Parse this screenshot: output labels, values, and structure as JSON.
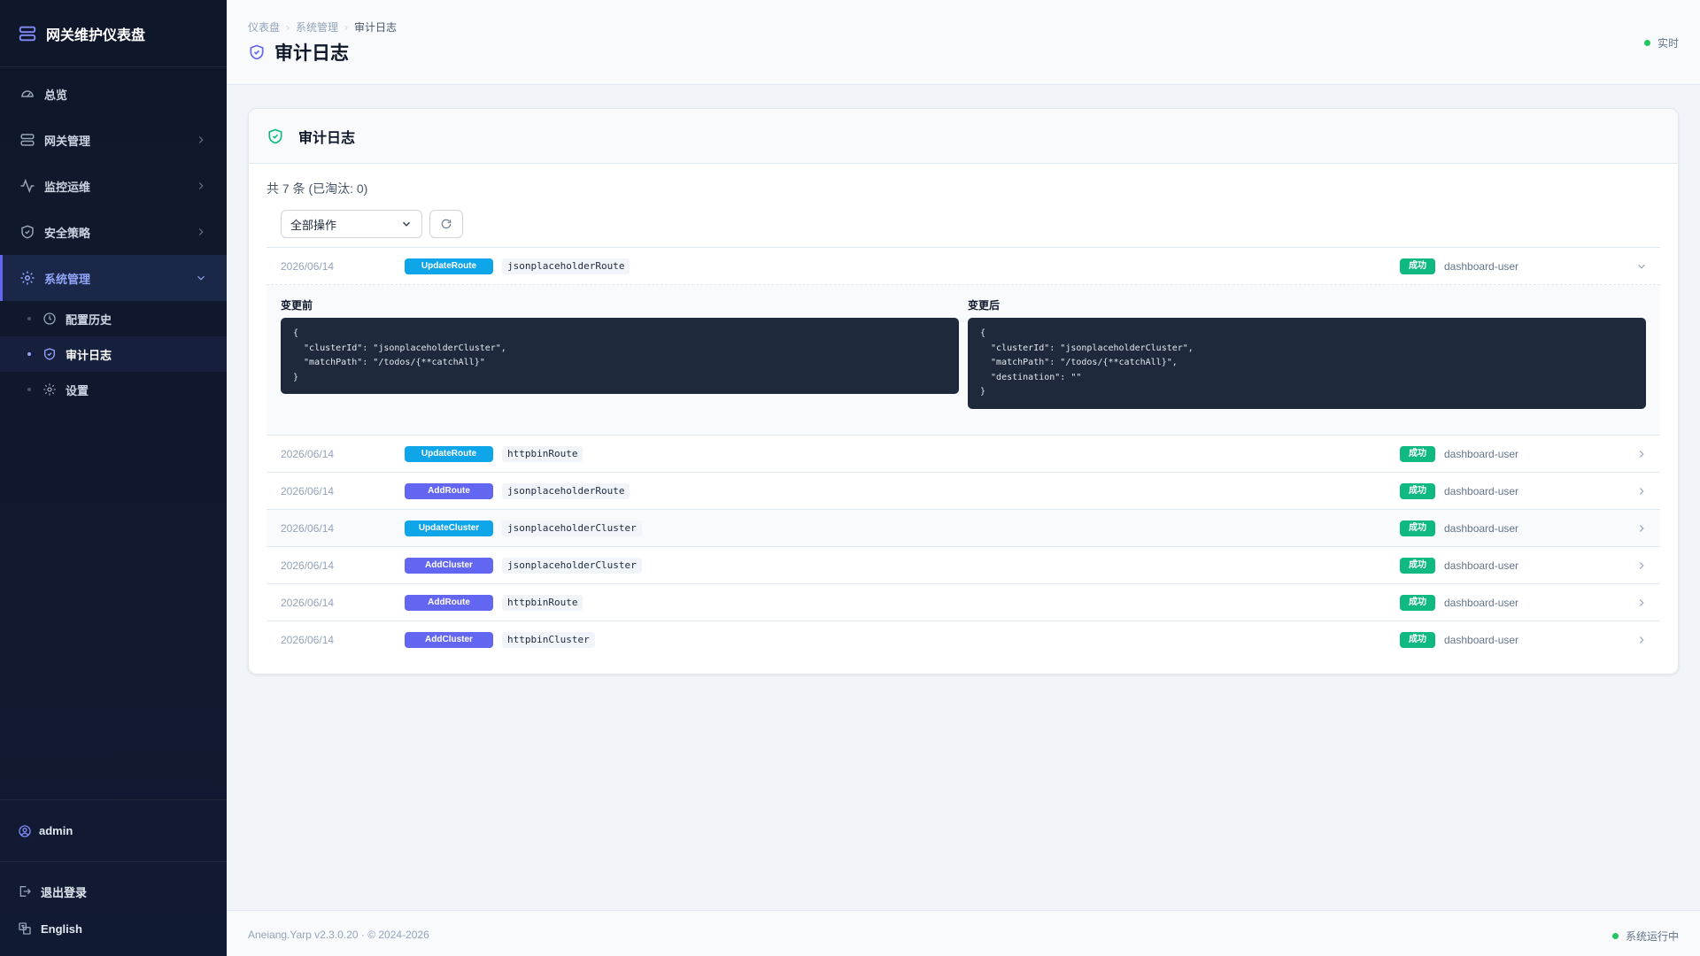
{
  "app": {
    "title": "网关维护仪表盘"
  },
  "sidebar": {
    "items": [
      {
        "label": "总览",
        "icon": "gauge-icon"
      },
      {
        "label": "网关管理",
        "icon": "server-icon"
      },
      {
        "label": "监控运维",
        "icon": "activity-icon"
      },
      {
        "label": "安全策略",
        "icon": "shield-icon"
      },
      {
        "label": "系统管理",
        "icon": "gear-icon"
      }
    ],
    "sub_items": [
      {
        "label": "配置历史",
        "icon": "history-icon"
      },
      {
        "label": "审计日志",
        "icon": "shield-check-icon"
      },
      {
        "label": "设置",
        "icon": "gear-icon"
      }
    ],
    "user": "admin",
    "logout": "退出登录",
    "language": "English"
  },
  "header": {
    "breadcrumb": [
      "仪表盘",
      "系统管理",
      "审计日志"
    ],
    "title": "审计日志",
    "realtime": "实时"
  },
  "card": {
    "title": "审计日志",
    "count_text": "共 7 条 (已淘汰: 0)",
    "filter": {
      "selected": "全部操作"
    }
  },
  "logs": [
    {
      "date": "2026/06/14",
      "action": "UpdateRoute",
      "target": "jsonplaceholderRoute",
      "status": "成功",
      "user": "dashboard-user"
    },
    {
      "date": "2026/06/14",
      "action": "UpdateRoute",
      "target": "httpbinRoute",
      "status": "成功",
      "user": "dashboard-user"
    },
    {
      "date": "2026/06/14",
      "action": "AddRoute",
      "target": "jsonplaceholderRoute",
      "status": "成功",
      "user": "dashboard-user"
    },
    {
      "date": "2026/06/14",
      "action": "UpdateCluster",
      "target": "jsonplaceholderCluster",
      "status": "成功",
      "user": "dashboard-user"
    },
    {
      "date": "2026/06/14",
      "action": "AddCluster",
      "target": "jsonplaceholderCluster",
      "status": "成功",
      "user": "dashboard-user"
    },
    {
      "date": "2026/06/14",
      "action": "AddRoute",
      "target": "httpbinRoute",
      "status": "成功",
      "user": "dashboard-user"
    },
    {
      "date": "2026/06/14",
      "action": "AddCluster",
      "target": "httpbinCluster",
      "status": "成功",
      "user": "dashboard-user"
    }
  ],
  "detail": {
    "before_label": "变更前",
    "before": "{\n  \"clusterId\": \"jsonplaceholderCluster\",\n  \"matchPath\": \"/todos/{**catchAll}\"\n}",
    "after_label": "变更后",
    "after": "{\n  \"clusterId\": \"jsonplaceholderCluster\",\n  \"matchPath\": \"/todos/{**catchAll}\",\n  \"destination\": \"\"\n}"
  },
  "footer": {
    "copyright": "Aneiang.Yarp v2.3.0.20 · © 2024-2026",
    "system_status": "系统运行中"
  },
  "colors": {
    "accent": "#6366f1",
    "update_badge": "#0ea5e9",
    "add_badge": "#6366f1",
    "success": "#10b981",
    "sidebar_bg": "#0f172a"
  }
}
